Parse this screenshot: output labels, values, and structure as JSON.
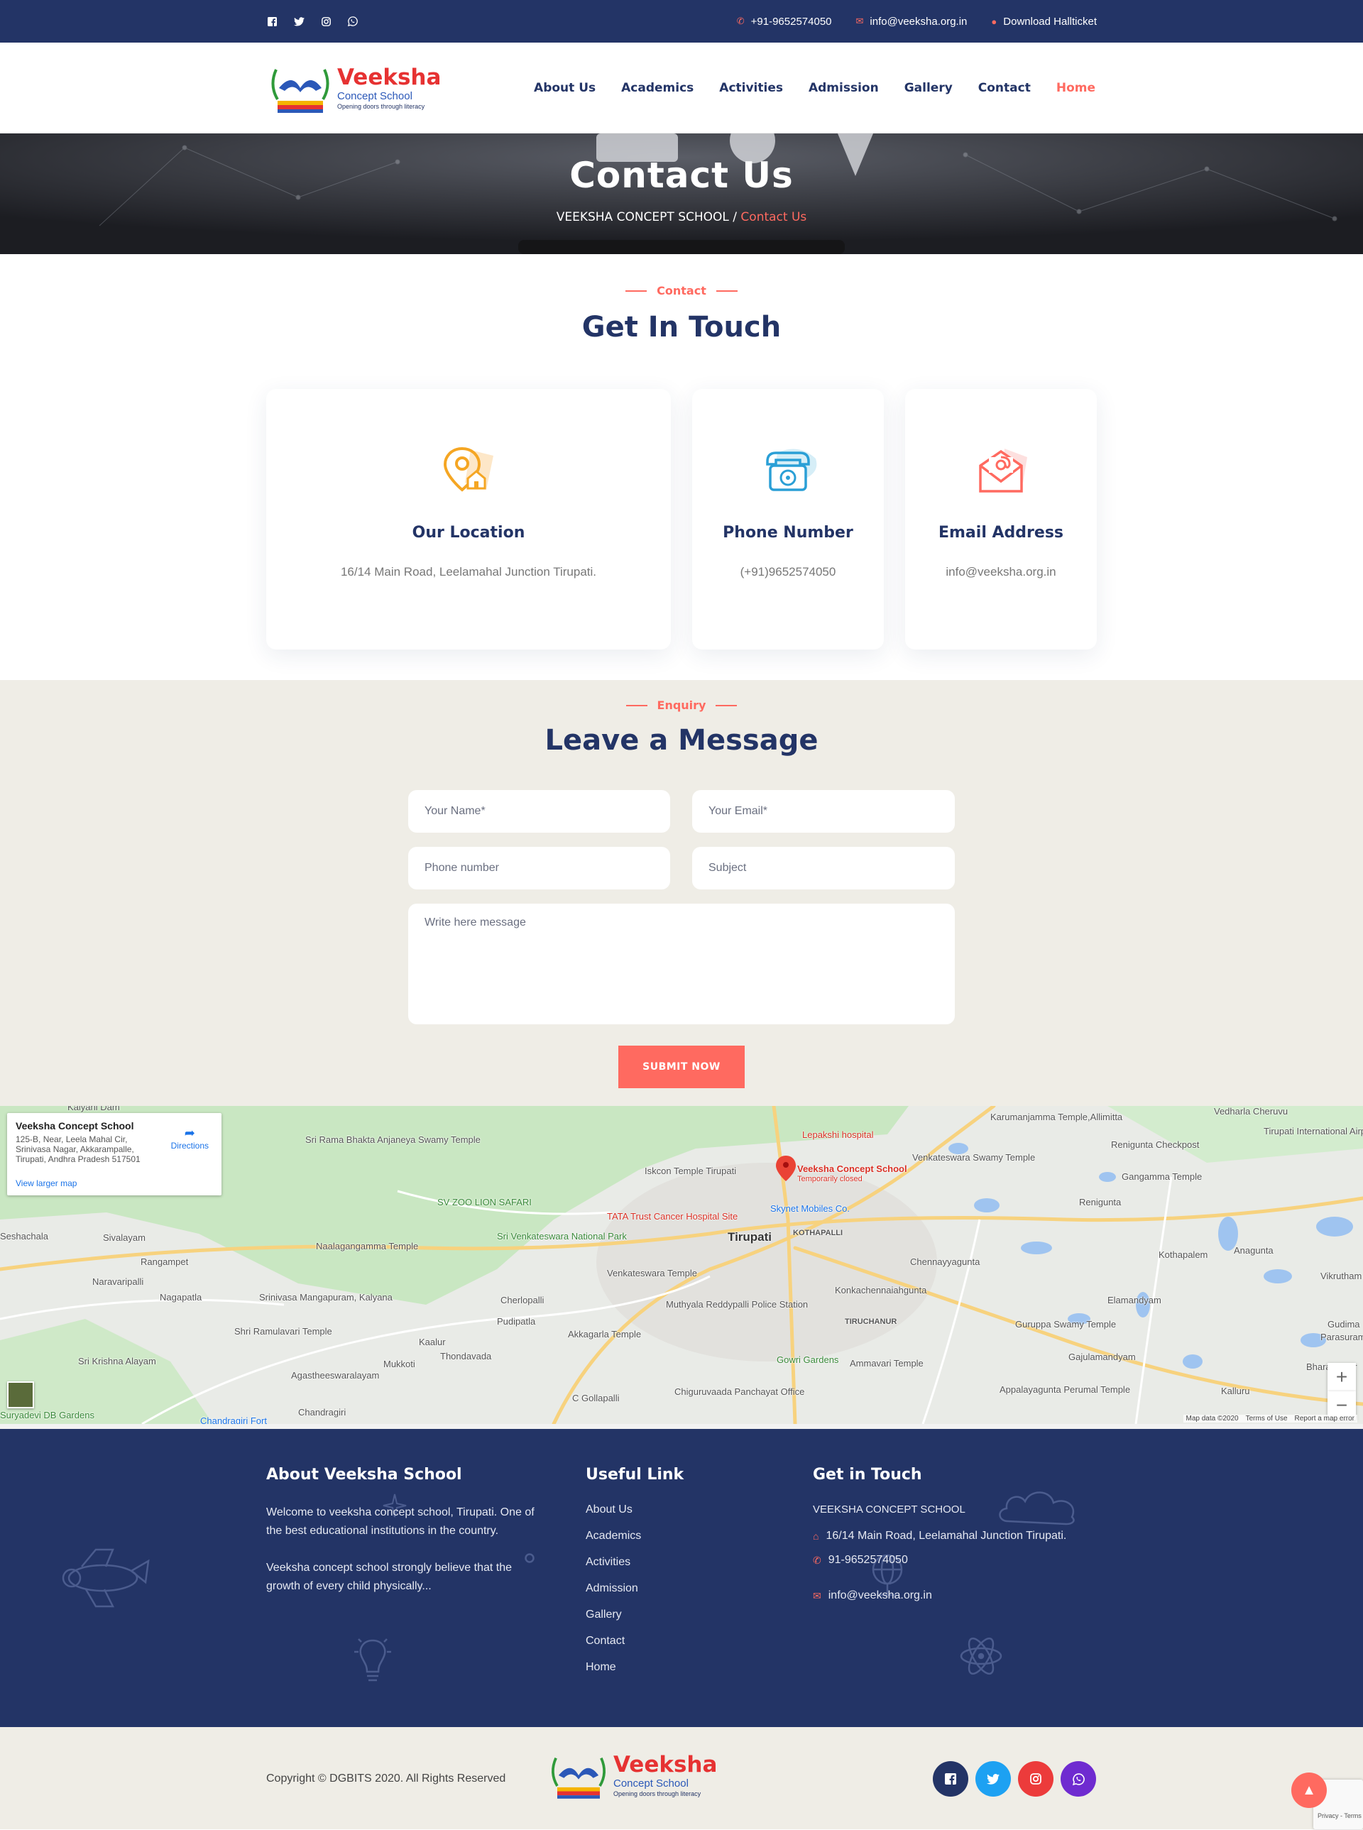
{
  "topbar": {
    "socials": [
      "facebook-icon",
      "twitter-icon",
      "instagram-icon",
      "whatsapp-icon"
    ],
    "phone": "+91-9652574050",
    "email": "info@veeksha.org.in",
    "download": "Download Hallticket"
  },
  "brand": {
    "name": "Veeksha",
    "sub": "Concept School",
    "tagline": "Opening doors through literacy"
  },
  "nav": [
    "About Us",
    "Academics",
    "Activities",
    "Admission",
    "Gallery",
    "Contact",
    "Home"
  ],
  "banner": {
    "title": "Contact Us",
    "crumb_home": "VEEKSHA CONCEPT SCHOOL",
    "crumb_sep": "/",
    "crumb_current": "Contact Us"
  },
  "contact": {
    "tag": "Contact",
    "title": "Get In Touch",
    "cards": [
      {
        "icon": "location-pin-icon",
        "title": "Our Location",
        "text": "16/14 Main Road, Leelamahal Junction Tirupati."
      },
      {
        "icon": "telephone-icon",
        "title": "Phone Number",
        "text": "(+91)9652574050"
      },
      {
        "icon": "envelope-icon",
        "title": "Email Address",
        "text": "info@veeksha.org.in"
      }
    ]
  },
  "enquiry": {
    "tag": "Enquiry",
    "title": "Leave a Message",
    "name_placeholder": "Your Name*",
    "email_placeholder": "Your Email*",
    "phone_placeholder": "Phone number",
    "subject_placeholder": "Subject",
    "message_placeholder": "Write here message",
    "submit": "SUBMIT NOW"
  },
  "map": {
    "place_name": "Veeksha Concept School",
    "place_address": "125-B, Near, Leela Mahal Cir, Srinivasa Nagar, Akkarampalle, Tirupati, Andhra Pradesh 517501",
    "directions": "Directions",
    "larger_map": "View larger map",
    "pin_label": "Veeksha Concept School",
    "pin_status": "Temporarily closed",
    "labels": [
      "Tirupati",
      "Sri Rama Bhakta Anjaneya Swamy Temple",
      "Iskcon Temple Tirupati",
      "SV ZOO LION SAFARI",
      "Sri Venkateswara National Park",
      "TATA Trust Cancer Hospital Site",
      "Skynet Mobiles Co.",
      "Lepakshi hospital",
      "Karumanjamma Temple,Allimitta",
      "Venkateswara Swamy Temple",
      "Gangamma Temple",
      "Renigunta Checkpost",
      "Renigunta",
      "Tirupati International Airport",
      "Vedharla Cheruvu",
      "Sivalayam",
      "Rangampet",
      "Naalagangamma Temple",
      "Naravaripalli",
      "Nagapatla",
      "Srinivasa Mangapuram, Kalyana",
      "Shri Ramulavari Temple",
      "Cherlopalli",
      "Pudipatla",
      "Venkateswara Temple",
      "Muthyala Reddypalli Police Station",
      "Akkagarla Temple",
      "KOTHAPALLI",
      "Konkachennaiahgunta",
      "Chennayyagunta",
      "TIRUCHANUR",
      "Kothapalem",
      "Anagunta",
      "Elamandyam",
      "Guruppa Swamy Temple",
      "Gajulamandyam",
      "Bharath amr",
      "Kalluru",
      "Appalayagunta Perumal Temple",
      "Ammavari Temple",
      "Gowri Gardens",
      "Chiguruvaada Panchayat Office",
      "C Gollapalli",
      "Thondavada",
      "Mukkoti",
      "Agastheeswaralayam",
      "Kaalur",
      "Sri Krishna Alayam",
      "Suryadevi DB Gardens",
      "Chandragiri",
      "Chandragiri Fort",
      "Seshachala",
      "Kalyani Dam",
      "Vikrutham",
      "Gudima",
      "Parasurameswara"
    ],
    "attribution": "Map data ©2020",
    "terms": "Terms of Use",
    "report": "Report a map error",
    "zoom_in": "+",
    "zoom_out": "−"
  },
  "footer": {
    "about_title": "About Veeksha School",
    "about_p1": "Welcome to veeksha concept school, Tirupati. One of the best educational institutions in the country.",
    "about_p2": "Veeksha concept school strongly believe that the growth of every child physically...",
    "links_title": "Useful Link",
    "links": [
      "About Us",
      "Academics",
      "Activities",
      "Admission",
      "Gallery",
      "Contact",
      "Home"
    ],
    "touch_title": "Get in Touch",
    "touch_name": "VEEKSHA CONCEPT SCHOOL",
    "touch_address": "16/14 Main Road, Leelamahal Junction Tirupati.",
    "touch_phone": "91-9652574050",
    "touch_email": "info@veeksha.org.in"
  },
  "bottom": {
    "copyright": "Copyright © DGBITS 2020. All Rights Reserved",
    "socials": [
      {
        "icon": "facebook-icon",
        "color": "#3b5998"
      },
      {
        "icon": "twitter-icon",
        "color": "#1da1f2"
      },
      {
        "icon": "instagram-icon",
        "color": "#e4405f"
      },
      {
        "icon": "whatsapp-icon",
        "color": "#6f2bd0"
      }
    ],
    "recaptcha": "Privacy - Terms"
  },
  "colors": {
    "navy": "#233466",
    "accent": "#ff6a60",
    "beige": "#efede6"
  }
}
